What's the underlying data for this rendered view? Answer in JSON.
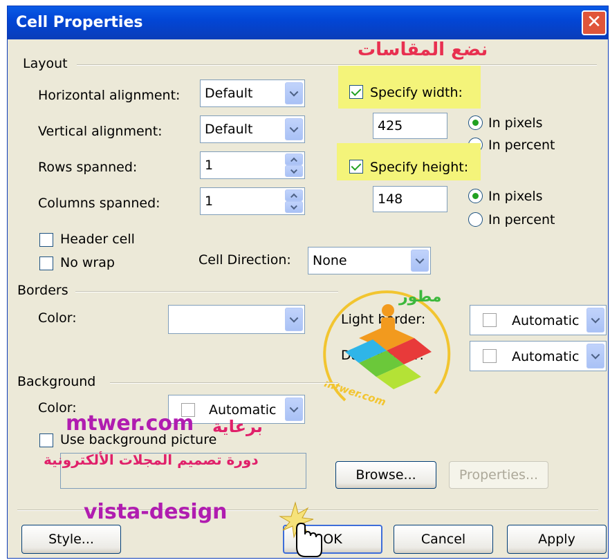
{
  "window": {
    "title": "Cell Properties",
    "close_glyph": "✕"
  },
  "overlay": {
    "heading_ar": "نضع المقاسات",
    "sponsor_site": "mtwer.com",
    "sponsor_ar": "برعاية",
    "course_ar": "دورة تصميم المجلات الألكترونية",
    "brand": "vista-design",
    "logo_text": "مطور",
    "logo_site": "mtwer.com"
  },
  "layout": {
    "section_label": "Layout",
    "horizontal_alignment_label": "Horizontal alignment:",
    "horizontal_alignment_value": "Default",
    "vertical_alignment_label": "Vertical alignment:",
    "vertical_alignment_value": "Default",
    "rows_spanned_label": "Rows spanned:",
    "rows_spanned_value": "1",
    "columns_spanned_label": "Columns spanned:",
    "columns_spanned_value": "1",
    "specify_width_label": "Specify width:",
    "width_value": "425",
    "width_unit_pixels": "In pixels",
    "width_unit_percent": "In percent",
    "specify_height_label": "Specify height:",
    "height_value": "148",
    "height_unit_pixels": "In pixels",
    "height_unit_percent": "In percent",
    "header_cell_label": "Header cell",
    "no_wrap_label": "No wrap",
    "cell_direction_label": "Cell Direction:",
    "cell_direction_value": "None"
  },
  "borders": {
    "section_label": "Borders",
    "color_label": "Color:",
    "color_value": "",
    "light_border_label": "Light border:",
    "light_border_value": "Automatic",
    "dark_border_label": "Dark border:",
    "dark_border_value": "Automatic"
  },
  "background": {
    "section_label": "Background",
    "color_label": "Color:",
    "color_value": "Automatic",
    "use_picture_label": "Use background picture",
    "browse_label": "Browse...",
    "properties_label": "Properties..."
  },
  "buttons": {
    "style_label": "Style...",
    "ok_label": "OK",
    "cancel_label": "Cancel",
    "apply_label": "Apply"
  },
  "colors": {
    "title_bar": "#0A5BE6",
    "dialog_bg": "#ECE9D8",
    "highlight": "#F4F47A",
    "arabic_text": "#E0206A",
    "watermark": "#B01CB0"
  }
}
